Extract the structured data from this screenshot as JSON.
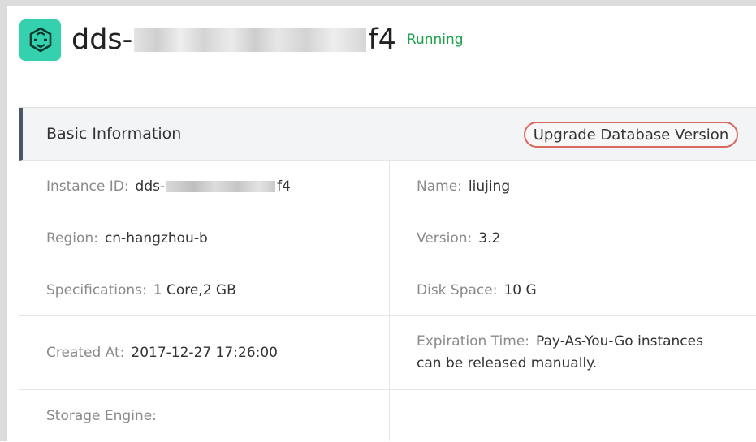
{
  "instance": {
    "title_prefix": "dds-",
    "title_suffix": "f4",
    "status": "Running",
    "status_color": "#1ba34a",
    "icon": "mongodb-hexagon-icon"
  },
  "panel": {
    "title": "Basic Information",
    "upgrade_label": "Upgrade Database Version"
  },
  "fields": {
    "instance_id_label": "Instance ID:",
    "instance_id_prefix": "dds-",
    "instance_id_suffix": "f4",
    "name_label": "Name:",
    "name_value": "liujing",
    "region_label": "Region:",
    "region_value": "cn-hangzhou-b",
    "version_label": "Version:",
    "version_value": "3.2",
    "spec_label": "Specifications:",
    "spec_value": "1 Core,2 GB",
    "disk_label": "Disk Space:",
    "disk_value": "10 G",
    "created_label": "Created At:",
    "created_value": "2017-12-27 17:26:00",
    "expiration_label": "Expiration Time:",
    "expiration_value_1": "Pay-As-You-Go instances",
    "expiration_value_2": "can be released manually.",
    "engine_label": "Storage Engine:"
  }
}
